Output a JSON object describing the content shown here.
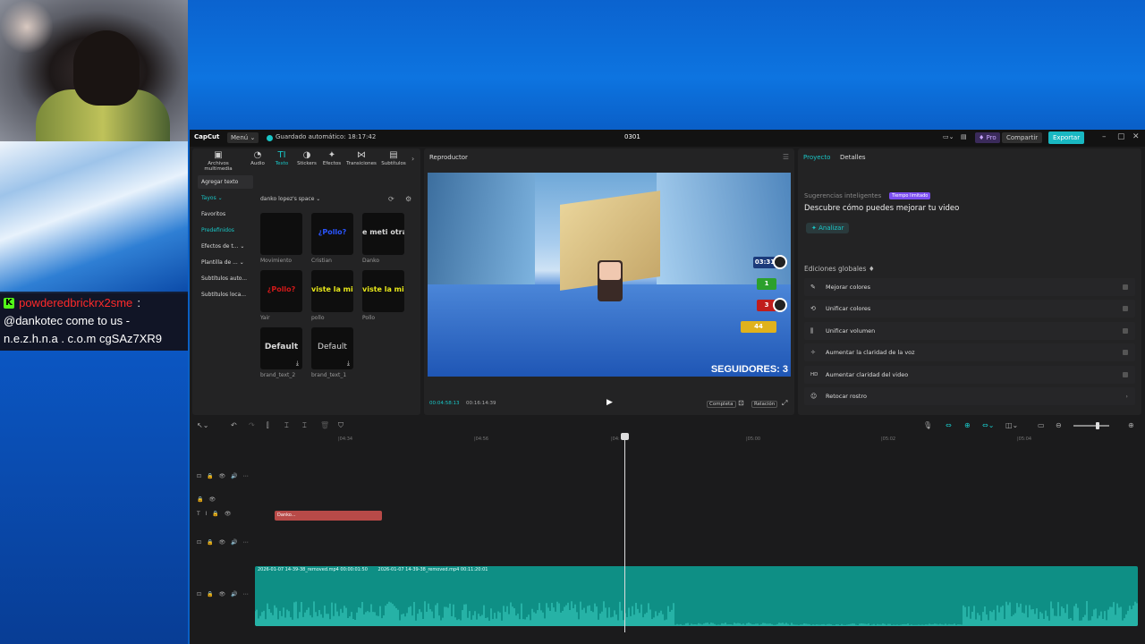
{
  "chat": {
    "username": "powderedbrickrx2sme",
    "separator": ":",
    "message_line1": "@dankotec come to us -",
    "message_line2": "n.e.z.h.n.a . c.o.m cgSAz7XR9"
  },
  "titlebar": {
    "app_name": "CapCut",
    "menu": "Menú ⌄",
    "autosave": "Guardado automático: 18:17:42",
    "project_name": "0301",
    "pro": "♦ Pro",
    "share": "Compartir",
    "export": "Exportar"
  },
  "tool_tabs": [
    {
      "label": "Archivos multimedia",
      "icon": "▣"
    },
    {
      "label": "Audio",
      "icon": "◔"
    },
    {
      "label": "Texto",
      "icon": "TI"
    },
    {
      "label": "Stickers",
      "icon": "◑"
    },
    {
      "label": "Efectos",
      "icon": "✦"
    },
    {
      "label": "Transiciones",
      "icon": "⋈"
    },
    {
      "label": "Subtítulos",
      "icon": "▤"
    }
  ],
  "categories": [
    "Agregar texto",
    "Tayos ⌄",
    "Favoritos",
    "Predefinidos",
    "Efectos de t... ⌄",
    "Plantilla de ... ⌄",
    "Subtítulos auto...",
    "Subtítulos loca..."
  ],
  "space_label": "danko lopez's space ⌄",
  "templates": [
    {
      "preview": "",
      "label": "Movimiento",
      "color": "#ffffff"
    },
    {
      "preview": "¿Pollo?",
      "label": "Cristian",
      "color": "#2a55ff"
    },
    {
      "preview": "e meti otra v",
      "label": "Danko",
      "color": "#ffffff"
    },
    {
      "preview": "¿Pollo?",
      "label": "Yair",
      "color": "#d11919"
    },
    {
      "preview": "viste la miniat",
      "label": "pollo",
      "color": "#e8e81a"
    },
    {
      "preview": "viste la miniat",
      "label": "Pollo",
      "color": "#e8e81a"
    },
    {
      "preview": "Default",
      "label": "brand_text_2",
      "color": "#ffffff"
    },
    {
      "preview": "Default",
      "label": "brand_text_1",
      "color": "#ffffff"
    }
  ],
  "player": {
    "title": "Reproductor",
    "time_current": "00:04:58:13",
    "time_total": "00:16:14:39",
    "full_btn": "Completa",
    "ratio_btn": "Relación",
    "followers": "SEGUIDORES: 3",
    "hud_timer": "03:31",
    "hud_green": "1",
    "hud_red": "3",
    "hud_yellow": "44"
  },
  "details": {
    "tab_project": "Proyecto",
    "tab_details": "Detalles",
    "suggestions_label": "Sugerencias inteligentes",
    "suggestions_badge": "Tiempo limitado",
    "discover": "Descubre cómo puedes mejorar tu video",
    "analyze": "✦ Analizar",
    "global_label": "Ediciones globales ♦",
    "edits": [
      {
        "icon": "✎",
        "label": "Mejorar colores"
      },
      {
        "icon": "⟲",
        "label": "Unificar colores"
      },
      {
        "icon": "⫼",
        "label": "Unificar volumen"
      },
      {
        "icon": "✧",
        "label": "Aumentar la claridad de la voz"
      },
      {
        "icon": "HD",
        "label": "Aumentar claridad del video"
      },
      {
        "icon": "☺",
        "label": "Retocar rostro"
      }
    ]
  },
  "timeline": {
    "ruler": [
      "|04:34",
      "|04:56",
      "|04:",
      "|05:00",
      "|05:02",
      "|05:04"
    ],
    "text_clip": "Danko...",
    "audio_clip_1": "2026-01-07 14-39-38_removed.mp4  00:00:01:50",
    "audio_clip_2": "2026-01-07 14-39-38_removed.mp4  00:11:20:01"
  }
}
